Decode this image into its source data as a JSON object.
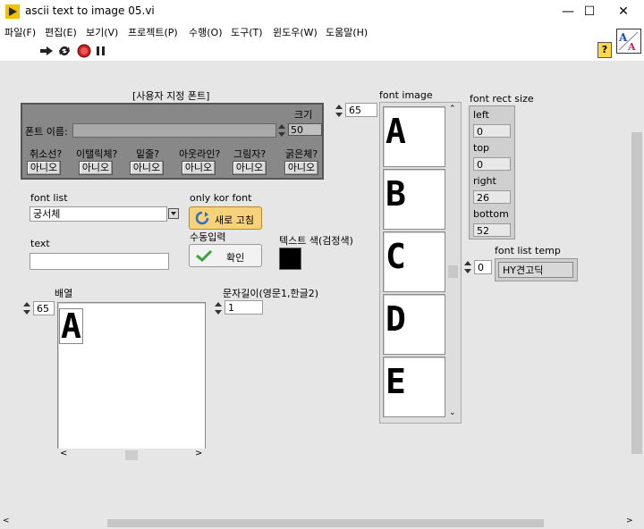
{
  "window": {
    "title": "ascii text to image 05.vi"
  },
  "menu": [
    "파일(F)",
    "편집(E)",
    "보기(V)",
    "프로젝트(P)",
    "수행(O)",
    "도구(T)",
    "윈도우(W)",
    "도움말(H)"
  ],
  "font_cluster": {
    "title": "[사용자 지정 폰트]",
    "size_label": "크기",
    "size_value": "50",
    "name_label": "폰트 이름:",
    "name_value": "",
    "toggles": [
      {
        "label": "취소선?",
        "value": "아니오"
      },
      {
        "label": "이탤릭체?",
        "value": "아니오"
      },
      {
        "label": "밑줄?",
        "value": "아니오"
      },
      {
        "label": "아웃라인?",
        "value": "아니오"
      },
      {
        "label": "그림자?",
        "value": "아니오"
      },
      {
        "label": "굵은체?",
        "value": "아니오"
      }
    ]
  },
  "font_list": {
    "label": "font list",
    "value": "궁서체"
  },
  "only_kor": {
    "label": "only kor font",
    "button": "새로 고침"
  },
  "manual": {
    "label": "수동입력",
    "button": "확인"
  },
  "text_field": {
    "label": "text",
    "value": ""
  },
  "text_color": {
    "label": "텍스트 색(검정색)",
    "color": "#000000"
  },
  "array": {
    "label": "배열",
    "index": "65",
    "items": [
      "A"
    ]
  },
  "length": {
    "label": "문자길이(영문1,한글2)",
    "value": "1"
  },
  "font_image": {
    "label": "font image",
    "index": "65",
    "items": [
      "A",
      "B",
      "C",
      "D",
      "E"
    ]
  },
  "font_rect": {
    "label": "font rect size",
    "left_label": "left",
    "left": "0",
    "top_label": "top",
    "top": "0",
    "right_label": "right",
    "right": "26",
    "bottom_label": "bottom",
    "bottom": "52"
  },
  "font_list_temp": {
    "label": "font list temp",
    "index": "0",
    "value": "HY견고딕"
  },
  "help_button": "?"
}
